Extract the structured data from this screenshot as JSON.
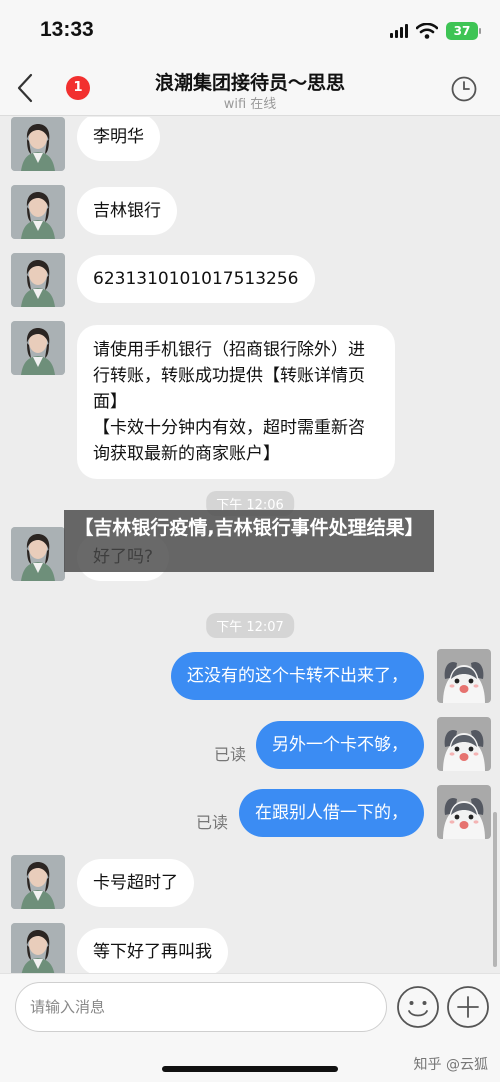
{
  "status_bar": {
    "time": "13:33",
    "battery": "37"
  },
  "header": {
    "unread_count": "1",
    "title": "浪潮集团接待员～思思",
    "subtitle": "wifi 在线"
  },
  "messages": [
    {
      "text": "李明华"
    },
    {
      "text": "吉林银行"
    },
    {
      "text": "6231310101017513256"
    },
    {
      "text": "请使用手机银行（招商银行除外）进行转账，转账成功提供【转账详情页面】\n【卡效十分钟内有效，超时需重新咨询获取最新的商家账户】"
    },
    {
      "text": "好了吗?"
    },
    {
      "text": "还没有的这个卡转不出来了，"
    },
    {
      "text": "另外一个卡不够，",
      "read": "已读"
    },
    {
      "text": "在跟别人借一下的，",
      "read": "已读"
    },
    {
      "text": "卡号超时了"
    },
    {
      "text": "等下好了再叫我"
    }
  ],
  "time_labels": [
    "下午 12:06",
    "下午 12:07"
  ],
  "overlay_caption": "【吉林银行疫情,吉林银行事件处理结果】",
  "input": {
    "placeholder": "请输入消息"
  },
  "watermark": "知乎 @云狐",
  "colors": {
    "accent": "#3b8cf3",
    "badge": "#f2302f",
    "battery": "#3ec455"
  }
}
